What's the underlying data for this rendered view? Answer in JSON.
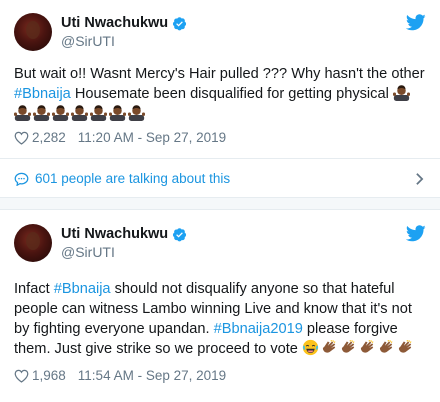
{
  "tweets": [
    {
      "name": "Uti Nwachukwu",
      "handle": "@SirUTI",
      "text_before": "But wait o!! Wasnt Mercy's Hair pulled ??? Why hasn't the other ",
      "hashtag1": "#Bbnaija",
      "text_after": " Housemate been disqualified for getting physical",
      "like_count": "2,282",
      "timestamp": "11:20 AM - Sep 27, 2019",
      "talk_label": "601 people are talking about this"
    },
    {
      "name": "Uti Nwachukwu",
      "handle": "@SirUTI",
      "seg1": "Infact  ",
      "hashtag1": "#Bbnaija",
      "seg2": " should not disqualify anyone so that hateful people can witness Lambo winning Live and know that it's not by fighting everyone upandan. ",
      "hashtag2": "#Bbnaija2019",
      "seg3": " please forgive them. Just give strike so we proceed to vote ",
      "like_count": "1,968",
      "timestamp": "11:54 AM - Sep 27, 2019"
    }
  ],
  "icons": {
    "verified": "verified-badge-icon",
    "twitter": "twitter-bird-icon",
    "like": "heart-icon",
    "reply": "speech-bubble-icon",
    "chevron": "chevron-right-icon",
    "emoji_shrug": "person-shrugging-emoji",
    "emoji_laugh": "face-with-tears-of-joy-emoji",
    "emoji_clap": "clapping-hands-emoji"
  },
  "colors": {
    "link": "#1b95e0",
    "muted": "#657786",
    "separator": "#e6ecf0"
  }
}
